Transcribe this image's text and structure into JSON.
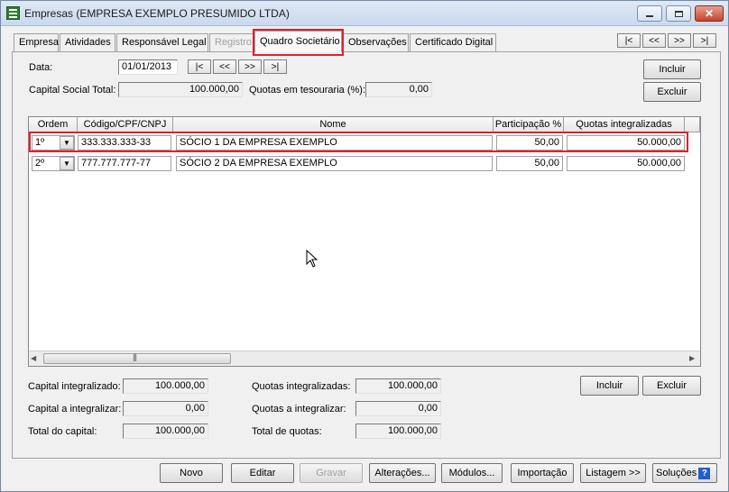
{
  "window": {
    "title": "Empresas (EMPRESA EXEMPLO PRESUMIDO LTDA)"
  },
  "tabs": [
    {
      "label": "Empresa",
      "state": "normal"
    },
    {
      "label": "Atividades",
      "state": "normal"
    },
    {
      "label": "Responsável Legal",
      "state": "normal"
    },
    {
      "label": "Registro",
      "state": "disabled"
    },
    {
      "label": "Quadro Societário",
      "state": "active"
    },
    {
      "label": "Observações",
      "state": "normal"
    },
    {
      "label": "Certificado Digital",
      "state": "normal"
    }
  ],
  "top_nav": [
    "|<",
    "<<",
    ">>",
    ">|"
  ],
  "date_nav": [
    "|<",
    "<<",
    ">>",
    ">|"
  ],
  "form": {
    "date_label": "Data:",
    "date_value": "01/01/2013",
    "capital_label": "Capital Social Total:",
    "capital_value": "100.000,00",
    "treasury_label": "Quotas em tesouraria (%):",
    "treasury_value": "0,00"
  },
  "top_buttons": {
    "incluir": "Incluir",
    "excluir": "Excluir"
  },
  "grid": {
    "columns": [
      "Ordem",
      "Código/CPF/CNPJ",
      "Nome",
      "Participação %",
      "Quotas integralizadas"
    ],
    "rows": [
      {
        "ordem": "1º",
        "codigo": "333.333.333-33",
        "nome": "SÓCIO 1 DA EMPRESA EXEMPLO",
        "participacao": "50,00",
        "quotas": "50.000,00"
      },
      {
        "ordem": "2º",
        "codigo": "777.777.777-77",
        "nome": "SÓCIO 2 DA EMPRESA EXEMPLO",
        "participacao": "50,00",
        "quotas": "50.000,00"
      }
    ]
  },
  "summary": {
    "capital_integralizado_label": "Capital integralizado:",
    "capital_integralizado_value": "100.000,00",
    "capital_a_integralizar_label": "Capital a integralizar:",
    "capital_a_integralizar_value": "0,00",
    "total_capital_label": "Total do capital:",
    "total_capital_value": "100.000,00",
    "quotas_integralizadas_label": "Quotas integralizadas:",
    "quotas_integralizadas_value": "100.000,00",
    "quotas_a_integralizar_label": "Quotas a integralizar:",
    "quotas_a_integralizar_value": "0,00",
    "total_quotas_label": "Total de quotas:",
    "total_quotas_value": "100.000,00"
  },
  "bottom_grid_buttons": {
    "incluir": "Incluir",
    "excluir": "Excluir"
  },
  "footer_buttons": {
    "novo": "Novo",
    "editar": "Editar",
    "gravar": "Gravar",
    "alteracoes": "Alterações...",
    "modulos": "Módulos...",
    "importacao": "Importação",
    "listagem": "Listagem >>",
    "solucoes": "Soluções"
  },
  "colors": {
    "highlight": "#e0202a",
    "help_icon": "#1e5fc8"
  }
}
